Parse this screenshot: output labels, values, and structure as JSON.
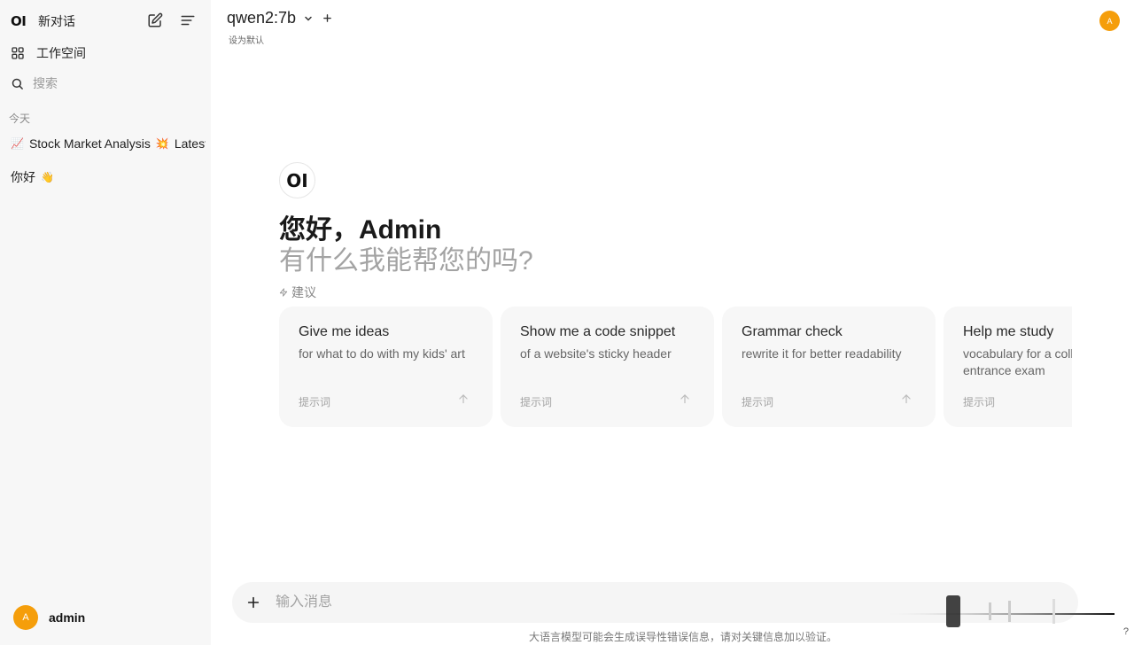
{
  "sidebar": {
    "logo": "OI",
    "new_chat_label": "新对话",
    "workspace_label": "工作空间",
    "search_placeholder": "搜索",
    "section_today": "今天",
    "chats": [
      {
        "emoji": "📈",
        "title": "Stock Market Analysis",
        "emoji2": "💥",
        "title2": "Latest"
      },
      {
        "title": "你好",
        "emoji": "👋"
      }
    ],
    "user": {
      "avatar_letter": "A",
      "name": "admin"
    }
  },
  "header": {
    "model": "qwen2:7b",
    "set_default": "设为默认",
    "avatar_letter": "A"
  },
  "hero": {
    "logo": "OI",
    "greeting": "您好，Admin",
    "subtitle": "有什么我能帮您的吗?",
    "suggestions_label": "建议"
  },
  "suggestions": [
    {
      "title": "Give me ideas",
      "desc": "for what to do with my kids' art",
      "tag": "提示词"
    },
    {
      "title": "Show me a code snippet",
      "desc": "of a website's sticky header",
      "tag": "提示词"
    },
    {
      "title": "Grammar check",
      "desc": "rewrite it for better readability",
      "tag": "提示词"
    },
    {
      "title": "Help me study",
      "desc": "vocabulary for a college entrance exam",
      "tag": "提示词"
    }
  ],
  "composer": {
    "placeholder": "输入消息",
    "disclaimer": "大语言模型可能会生成误导性错误信息，请对关键信息加以验证。",
    "help": "?"
  },
  "colors": {
    "avatar": "#f59e0b",
    "sidebar_bg": "#f7f7f7",
    "card_bg": "#f7f7f7"
  },
  "icons": [
    "new-chat-edit-icon",
    "sidebar-toggle-icon",
    "workspace-grid-icon",
    "search-icon",
    "chevron-down-icon",
    "plus-icon",
    "bolt-icon",
    "arrow-up-icon"
  ]
}
